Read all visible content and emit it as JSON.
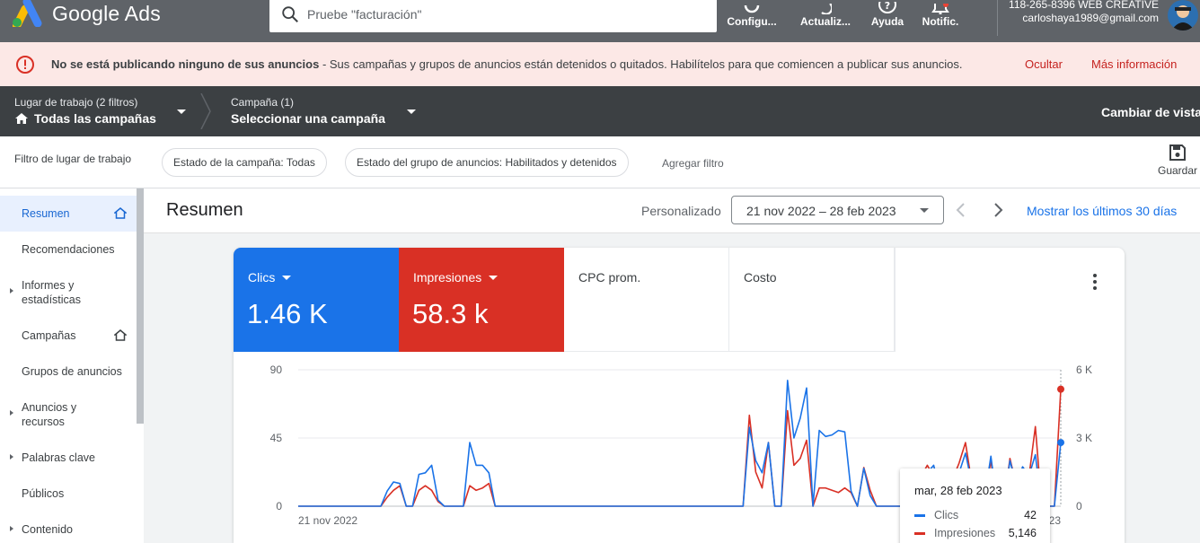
{
  "app": {
    "name": "Google Ads"
  },
  "search": {
    "placeholder": "Pruebe \"facturación\""
  },
  "toolbar": [
    {
      "label": "Configu...",
      "icon": "wrench-icon"
    },
    {
      "label": "Actualiz...",
      "icon": "refresh-icon"
    },
    {
      "label": "Ayuda",
      "icon": "help-icon"
    },
    {
      "label": "Notific.",
      "icon": "bell-icon"
    }
  ],
  "account": {
    "line1": "118-265-8396 WEB CREATIVE",
    "email": "carloshaya1989@gmail.com"
  },
  "alert": {
    "title": "No se está publicando ninguno de sus anuncios",
    "message": " - Sus campañas y grupos de anuncios están detenidos o quitados. Habilítelos para que comiencen a publicar sus anuncios.",
    "hide": "Ocultar",
    "more": "Más información",
    "color": "#d93025"
  },
  "nav": {
    "workspace_label": "Lugar de trabajo (2 filtros)",
    "workspace_value": "Todas las campañas",
    "campaign_label": "Campaña (1)",
    "campaign_value": "Seleccionar una campaña",
    "change_view": "Cambiar de vista"
  },
  "filters": {
    "label": "Filtro de lugar de trabajo",
    "chip1": "Estado de la campaña: Todas",
    "chip2": "Estado del grupo de anuncios: Habilitados y detenidos",
    "add": "Agregar filtro",
    "save": "Guardar"
  },
  "sidebar": {
    "items": [
      {
        "label": "Resumen",
        "active": true
      },
      {
        "label": "Recomendaciones"
      },
      {
        "label": "Informes y estadísticas"
      },
      {
        "label": "Campañas"
      },
      {
        "label": "Grupos de anuncios"
      },
      {
        "label": "Anuncios y recursos"
      },
      {
        "label": "Palabras clave"
      },
      {
        "label": "Públicos"
      },
      {
        "label": "Contenido"
      }
    ]
  },
  "main": {
    "title": "Resumen",
    "period_label": "Personalizado",
    "date_range": "21 nov 2022 – 28 feb 2023",
    "last30": "Mostrar los últimos 30 días"
  },
  "metrics": [
    {
      "label": "Clics",
      "value": "1.46 K",
      "color": "#1a73e8"
    },
    {
      "label": "Impresiones",
      "value": "58.3 k",
      "color": "#d93025"
    },
    {
      "label": "CPC prom.",
      "value": ""
    },
    {
      "label": "Costo",
      "value": ""
    }
  ],
  "tooltip": {
    "date": "mar, 28 feb 2023",
    "clicks_label": "Clics",
    "clicks_value": "42",
    "impr_label": "Impresiones",
    "impr_value": "5,146"
  },
  "chart_data": {
    "type": "line",
    "x_start_label": "21 nov 2022",
    "x_end_label": "28 feb 2023",
    "y_left_ticks": [
      "0",
      "45",
      "90"
    ],
    "y_right_ticks": [
      "0",
      "3 K",
      "6 K"
    ],
    "ylim_left": [
      0,
      90
    ],
    "ylim_right": [
      0,
      6000
    ],
    "series": [
      {
        "name": "Clics",
        "axis": "left",
        "color": "#1a73e8",
        "values": [
          0,
          0,
          0,
          0,
          0,
          0,
          0,
          0,
          0,
          0,
          0,
          0,
          0,
          0,
          10,
          16,
          15,
          0,
          0,
          21,
          22,
          27,
          4,
          0,
          0,
          0,
          0,
          42,
          27,
          27,
          22,
          0,
          0,
          0,
          0,
          0,
          0,
          0,
          0,
          0,
          0,
          0,
          0,
          0,
          0,
          0,
          0,
          0,
          0,
          0,
          0,
          0,
          0,
          0,
          0,
          0,
          0,
          0,
          0,
          0,
          0,
          0,
          0,
          0,
          0,
          0,
          0,
          0,
          0,
          0,
          0,
          52,
          30,
          22,
          42,
          0,
          0,
          83,
          45,
          58,
          78,
          0,
          50,
          46,
          47,
          50,
          49,
          10,
          0,
          25,
          7,
          0,
          0,
          0,
          0,
          0,
          0,
          0,
          12,
          22,
          27,
          9,
          0,
          15,
          22,
          35,
          15,
          13,
          5,
          33,
          0,
          0,
          30,
          14,
          26,
          20,
          34,
          0,
          0,
          0,
          42
        ]
      },
      {
        "name": "Impresiones",
        "axis": "right",
        "color": "#d93025",
        "values": [
          0,
          0,
          0,
          0,
          0,
          0,
          0,
          0,
          0,
          0,
          0,
          0,
          0,
          0,
          400,
          700,
          900,
          0,
          0,
          700,
          900,
          700,
          200,
          0,
          0,
          0,
          0,
          900,
          700,
          800,
          1000,
          0,
          0,
          0,
          0,
          0,
          0,
          0,
          0,
          0,
          0,
          0,
          0,
          0,
          0,
          0,
          0,
          0,
          0,
          0,
          0,
          0,
          0,
          0,
          0,
          0,
          0,
          0,
          0,
          0,
          0,
          0,
          0,
          0,
          0,
          0,
          0,
          0,
          0,
          0,
          0,
          4000,
          1500,
          800,
          2800,
          0,
          0,
          4200,
          1800,
          2100,
          2900,
          0,
          800,
          800,
          700,
          600,
          800,
          600,
          0,
          1700,
          700,
          0,
          0,
          0,
          0,
          0,
          0,
          0,
          1300,
          1800,
          1300,
          500,
          0,
          1200,
          1900,
          2800,
          1000,
          800,
          400,
          2000,
          0,
          0,
          2100,
          900,
          1500,
          1300,
          3500,
          0,
          0,
          0,
          5146
        ]
      }
    ],
    "grid": true,
    "legend": "tooltip"
  }
}
